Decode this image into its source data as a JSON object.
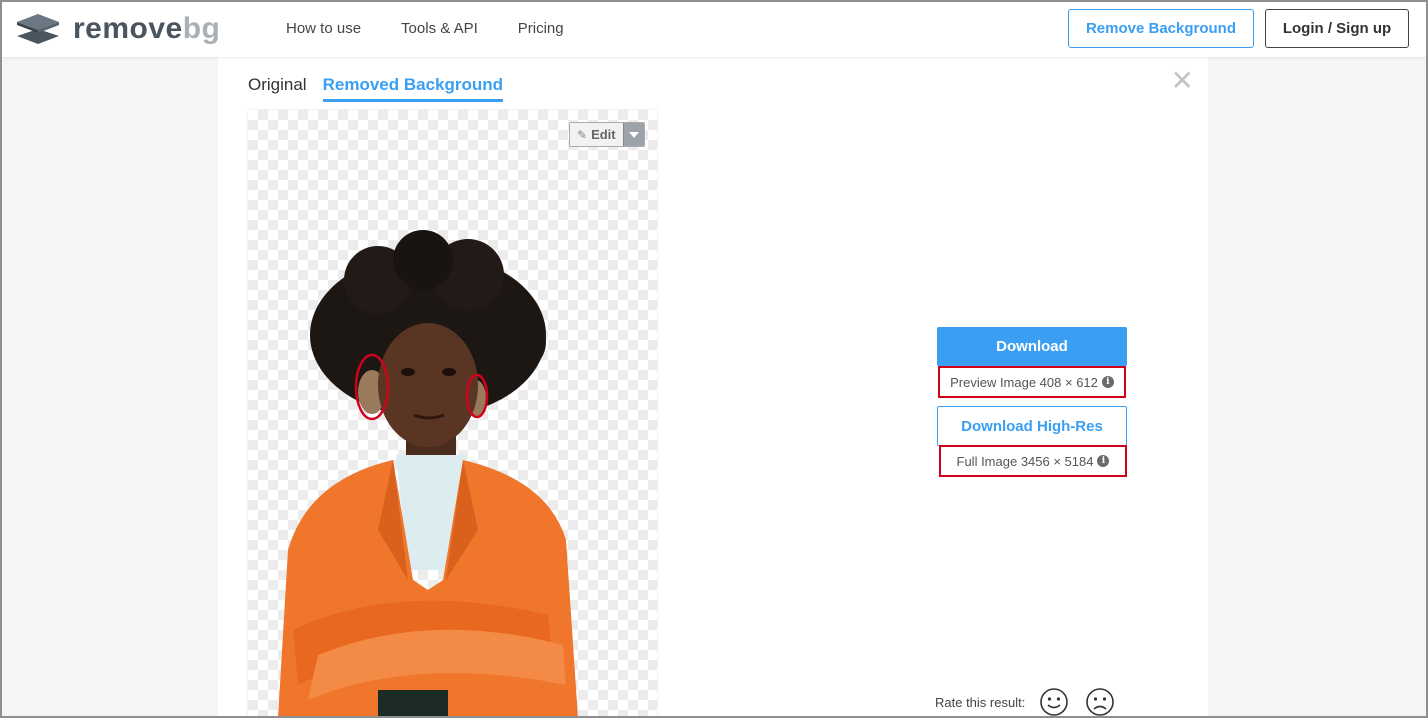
{
  "header": {
    "logo_main": "remove",
    "logo_accent": "bg",
    "nav": [
      "How to use",
      "Tools & API",
      "Pricing"
    ],
    "remove_button": "Remove Background",
    "login_button": "Login / Sign up"
  },
  "tabs": {
    "original": "Original",
    "removed": "Removed Background"
  },
  "close_label": "✕",
  "edit": {
    "label": "Edit"
  },
  "download": {
    "label": "Download",
    "preview_info": "Preview Image 408 × 612",
    "hr_label": "Download High-Res",
    "full_info": "Full Image 3456 × 5184"
  },
  "rate": {
    "label": "Rate this result:"
  },
  "colors": {
    "accent": "#3a9ff2",
    "highlight": "#d0021b",
    "jacket": "#f0762c"
  },
  "icons": [
    "logo-icon",
    "pencil-icon",
    "caret-down-icon",
    "info-icon",
    "close-icon",
    "smile-icon",
    "frown-icon"
  ]
}
